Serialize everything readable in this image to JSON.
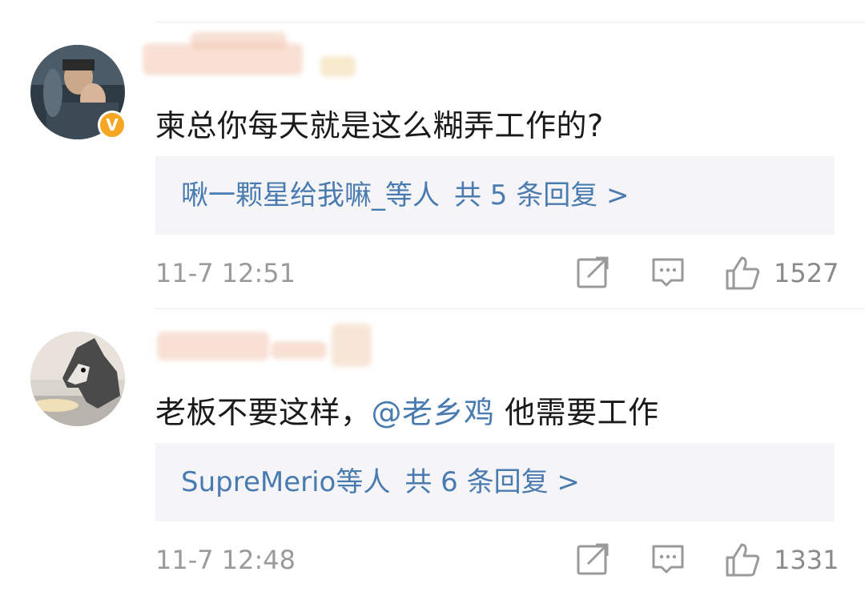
{
  "comments": [
    {
      "username": "",
      "text": "柬总你每天就是这么糊弄工作的?",
      "replies": {
        "users": "啾一颗星给我嘛_等人",
        "count_text": "共 5 条回复 >"
      },
      "timestamp": "11-7 12:51",
      "likes": "1527",
      "icons": [
        "share-icon",
        "comment-icon",
        "like-icon"
      ],
      "verified_badge": "V"
    },
    {
      "username": "",
      "text_before": "老板不要这样，",
      "mention": "@老乡鸡",
      "text_after": " 他需要工作",
      "replies": {
        "users": "SupreMerio等人",
        "count_text": "共 6 条回复 >"
      },
      "timestamp": "11-7 12:48",
      "likes": "1331",
      "icons": [
        "share-icon",
        "comment-icon",
        "like-icon"
      ]
    }
  ],
  "colors": {
    "link": "#4a7bb0",
    "text": "#1a1a1a",
    "meta": "#9a9a9a",
    "reply_bg": "#f5f5f7",
    "badge": "#f5a623"
  }
}
